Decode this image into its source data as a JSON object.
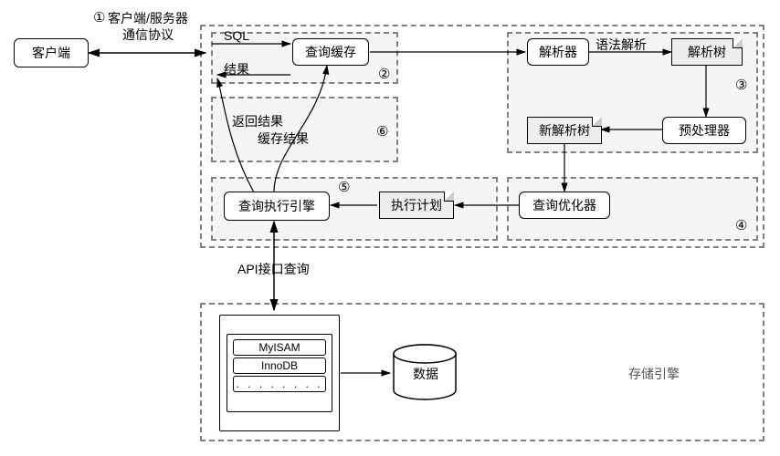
{
  "nodes": {
    "client": "客户端",
    "protocol_line1": "客户端/服务器",
    "protocol_line2": "通信协议",
    "query_cache": "查询缓存",
    "parser": "解析器",
    "syntax_parse": "语法解析",
    "parse_tree": "解析树",
    "new_parse_tree": "新解析树",
    "preprocessor": "预处理器",
    "optimizer": "查询优化器",
    "exec_plan": "执行计划",
    "exec_engine": "查询执行引擎",
    "return_result": "返回结果",
    "cache_result": "缓存结果",
    "api_label": "API接口查询",
    "sql": "SQL",
    "result": "结果",
    "engine1": "MyISAM",
    "engine2": "InnoDB",
    "engine_dots": ". . . . . . . .",
    "data_db": "数据",
    "storage_engine": "存储引擎"
  },
  "marks": {
    "m1": "①",
    "m2": "②",
    "m3": "③",
    "m4": "④",
    "m5": "⑤",
    "m6": "⑥"
  }
}
